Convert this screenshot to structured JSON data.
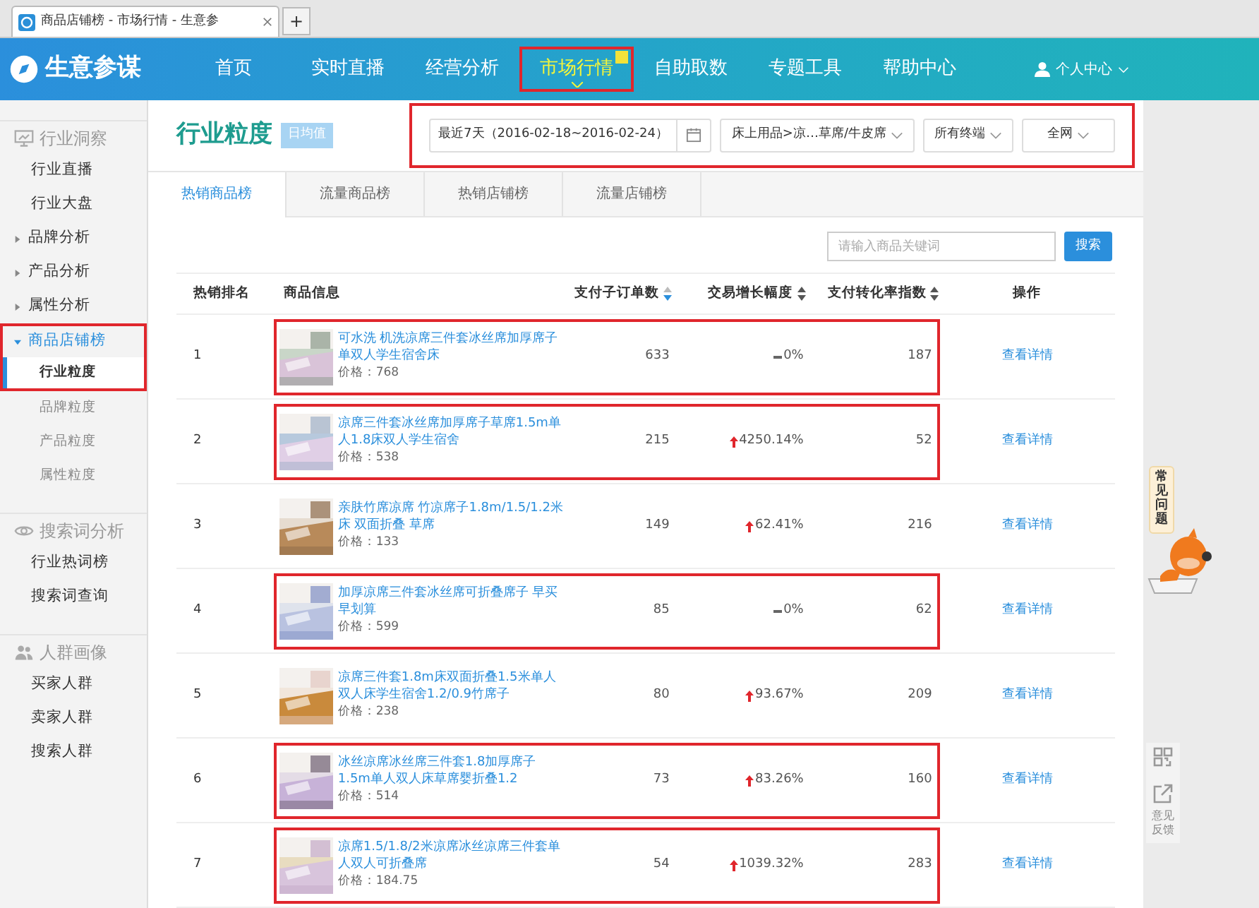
{
  "browser": {
    "tab_title": "商品店铺榜 - 市场行情 - 生意参",
    "new_tab": "+"
  },
  "nav": {
    "logo": "生意参谋",
    "items": [
      {
        "label": "首页",
        "selected": false,
        "highlighted": false
      },
      {
        "label": "实时直播",
        "selected": false,
        "highlighted": false
      },
      {
        "label": "经营分析",
        "selected": false,
        "highlighted": false
      },
      {
        "label": "市场行情",
        "selected": true,
        "highlighted": true
      },
      {
        "label": "自助取数",
        "selected": false,
        "highlighted": false
      },
      {
        "label": "专题工具",
        "selected": false,
        "highlighted": false
      },
      {
        "label": "帮助中心",
        "selected": false,
        "highlighted": false
      }
    ],
    "user": "个人中心"
  },
  "sidebar": {
    "groups": [
      {
        "title": "行业洞察",
        "items": [
          {
            "label": "行业直播",
            "kind": "link",
            "selected": false,
            "highlighted": false
          },
          {
            "label": "行业大盘",
            "kind": "link",
            "selected": false,
            "highlighted": false
          },
          {
            "label": "品牌分析",
            "kind": "expandable",
            "expanded": false,
            "highlighted": false
          },
          {
            "label": "产品分析",
            "kind": "expandable",
            "expanded": false,
            "highlighted": false
          },
          {
            "label": "属性分析",
            "kind": "expandable",
            "expanded": false,
            "highlighted": false
          },
          {
            "label": "商品店铺榜",
            "kind": "expandable",
            "expanded": true,
            "highlighted": true,
            "children": [
              {
                "label": "行业粒度",
                "selected": true,
                "highlighted": true
              },
              {
                "label": "品牌粒度",
                "selected": false,
                "highlighted": false
              },
              {
                "label": "产品粒度",
                "selected": false,
                "highlighted": false
              },
              {
                "label": "属性粒度",
                "selected": false,
                "highlighted": false
              }
            ]
          }
        ]
      },
      {
        "title": "搜索词分析",
        "items": [
          {
            "label": "行业热词榜",
            "kind": "link",
            "selected": false,
            "highlighted": false
          },
          {
            "label": "搜索词查询",
            "kind": "link",
            "selected": false,
            "highlighted": false
          }
        ]
      },
      {
        "title": "人群画像",
        "items": [
          {
            "label": "买家人群",
            "kind": "link",
            "selected": false,
            "highlighted": false
          },
          {
            "label": "卖家人群",
            "kind": "link",
            "selected": false,
            "highlighted": false
          },
          {
            "label": "搜索人群",
            "kind": "link",
            "selected": false,
            "highlighted": false
          }
        ]
      }
    ]
  },
  "header": {
    "title": "行业粒度",
    "tag": "日均值"
  },
  "filters": {
    "highlighted": true,
    "date": "最近7天（2016-02-18~2016-02-24）",
    "category": "床上用品>凉…草席/牛皮席",
    "terminal": "所有终端",
    "network": "全网"
  },
  "tabs": [
    {
      "label": "热销商品榜",
      "selected": true
    },
    {
      "label": "流量商品榜",
      "selected": false
    },
    {
      "label": "热销店铺榜",
      "selected": false
    },
    {
      "label": "流量店铺榜",
      "selected": false
    }
  ],
  "search": {
    "placeholder": "请输入商品关键词",
    "button": "搜索"
  },
  "table": {
    "columns": [
      {
        "label": "热销排名",
        "kind": "plain"
      },
      {
        "label": "商品信息",
        "kind": "plain"
      },
      {
        "label": "支付子订单数",
        "kind": "sortable",
        "sorted": true
      },
      {
        "label": "交易增长幅度",
        "kind": "sortable",
        "sorted": false
      },
      {
        "label": "支付转化率指数",
        "kind": "sortable",
        "sorted": false
      },
      {
        "label": "操作",
        "kind": "plain"
      }
    ],
    "rows": [
      {
        "rank": "1",
        "title": "可水洗 机洗凉席三件套冰丝席加厚席子单双人学生宿舍床",
        "price": "价格：768",
        "orders": "633",
        "kind": "flat",
        "growth": "0%",
        "conversion": "187",
        "action": "查看详情",
        "highlighted": true
      },
      {
        "rank": "2",
        "title": "凉席三件套冰丝席加厚席子草席1.5m单人1.8床双人学生宿舍",
        "price": "价格：538",
        "orders": "215",
        "kind": "up",
        "growth": "4250.14%",
        "conversion": "52",
        "action": "查看详情",
        "highlighted": true
      },
      {
        "rank": "3",
        "title": "亲肤竹席凉席 竹凉席子1.8m/1.5/1.2米床 双面折叠 草席",
        "price": "价格：133",
        "orders": "149",
        "kind": "up",
        "growth": "62.41%",
        "conversion": "216",
        "action": "查看详情",
        "highlighted": false
      },
      {
        "rank": "4",
        "title": "加厚凉席三件套冰丝席可折叠席子 早买早划算",
        "price": "价格：599",
        "orders": "85",
        "kind": "flat",
        "growth": "0%",
        "conversion": "62",
        "action": "查看详情",
        "highlighted": true
      },
      {
        "rank": "5",
        "title": "凉席三件套1.8m床双面折叠1.5米单人双人床学生宿舍1.2/0.9竹席子",
        "price": "价格：238",
        "orders": "80",
        "kind": "up",
        "growth": "93.67%",
        "conversion": "209",
        "action": "查看详情",
        "highlighted": false
      },
      {
        "rank": "6",
        "title": "冰丝凉席冰丝席三件套1.8加厚席子1.5m单人双人床草席婴折叠1.2",
        "price": "价格：514",
        "orders": "73",
        "kind": "up",
        "growth": "83.26%",
        "conversion": "160",
        "action": "查看详情",
        "highlighted": true
      },
      {
        "rank": "7",
        "title": "凉席1.5/1.8/2米凉席冰丝凉席三件套单人双人可折叠席",
        "price": "价格：184.75",
        "orders": "54",
        "kind": "up",
        "growth": "1039.32%",
        "conversion": "283",
        "action": "查看详情",
        "highlighted": true
      }
    ]
  },
  "side_tools": {
    "faq": "常见问题",
    "feedback": "意见反馈"
  }
}
